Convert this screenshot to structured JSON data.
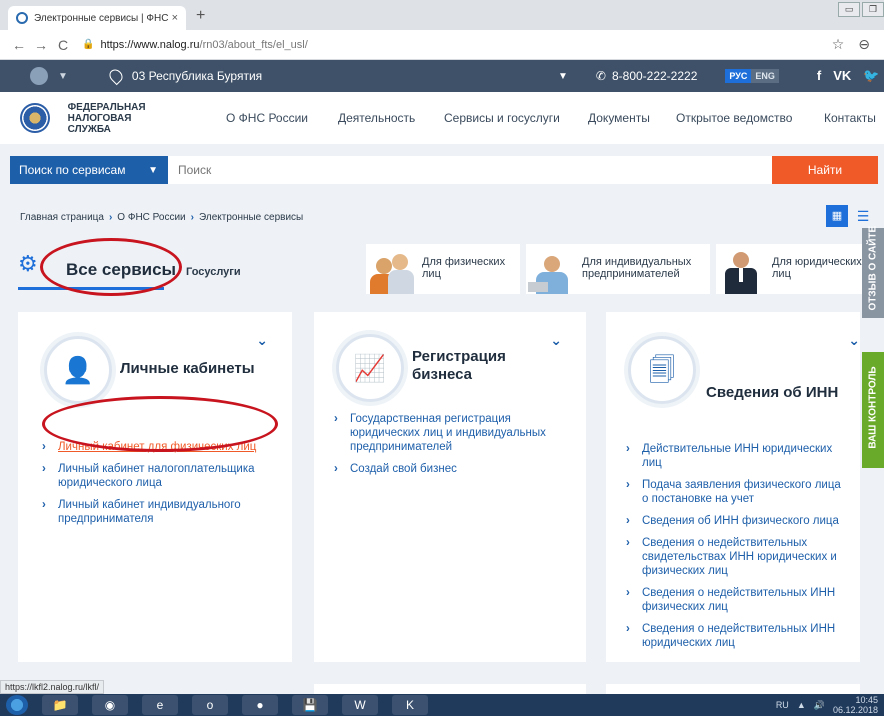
{
  "browser": {
    "tab_title": "Электронные сервисы | ФНС Ро",
    "tab_close": "×",
    "new_tab": "+",
    "url_host": "https://www.nalog.ru",
    "url_path": "/rn03/about_fts/el_usl/",
    "back": "←",
    "forward": "→",
    "reload": "C",
    "bookmark": "☆",
    "profile": "⊖"
  },
  "topbar": {
    "region": "03 Республика Бурятия",
    "phone": "8-800-222-2222",
    "lang_ru": "РУС",
    "lang_en": "ENG",
    "social": [
      "f",
      "VK",
      "🐦"
    ]
  },
  "header": {
    "brand_line1": "ФЕДЕРАЛЬНАЯ",
    "brand_line2": "НАЛОГОВАЯ СЛУЖБА",
    "nav": [
      "О ФНС России",
      "Деятельность",
      "Сервисы и госуслуги",
      "Документы",
      "Открытое ведомство",
      "Контакты"
    ]
  },
  "search": {
    "scope": "Поиск по сервисам",
    "placeholder": "Поиск",
    "button": "Найти"
  },
  "breadcrumb": [
    "Главная страница",
    "О ФНС России",
    "Электронные сервисы"
  ],
  "tabs": {
    "all": "Все сервисы",
    "gos": "Госуслуги",
    "audience": [
      {
        "line1": "Для физических",
        "line2": "лиц"
      },
      {
        "line1": "Для индивидуальных",
        "line2": "предпринимателей"
      },
      {
        "line1": "Для юридических",
        "line2": "лиц"
      }
    ]
  },
  "cards": [
    {
      "title": "Личные кабинеты",
      "links": [
        "Личный кабинет для физических лиц",
        "Личный кабинет налогоплательщика юридического лица",
        "Личный кабинет индивидуального предпринимателя"
      ]
    },
    {
      "title_line1": "Регистрация",
      "title_line2": "бизнеса",
      "links": [
        "Государственная регистрация юридических лиц и индивидуальных предпринимателей",
        "Создай свой бизнес"
      ]
    },
    {
      "title": "Сведения об ИНН",
      "links": [
        "Действительные ИНН юридических лиц",
        "Подача заявления физического лица о постановке на учет",
        "Сведения об ИНН физического лица",
        "Сведения о недействительных свидетельствах ИНН юридических и физических лиц",
        "Сведения о недействительных ИНН физических лиц",
        "Сведения о недействительных ИНН юридических лиц"
      ]
    }
  ],
  "side_tabs": {
    "feedback": "ОТЗЫВ О САЙТЕ",
    "control": "ВАШ КОНТРОЛЬ"
  },
  "status_url": "https://lkfl2.nalog.ru/lkfl/",
  "taskbar": {
    "lang": "RU",
    "time": "10:45",
    "date": "06.12.2018"
  },
  "colors": {
    "primary": "#1e5faa",
    "accent": "#f05a28",
    "topbar": "#3e5168",
    "annotation": "#c8141e",
    "control_tab": "#6aaa2a",
    "feedback_tab": "#8a95a2"
  }
}
